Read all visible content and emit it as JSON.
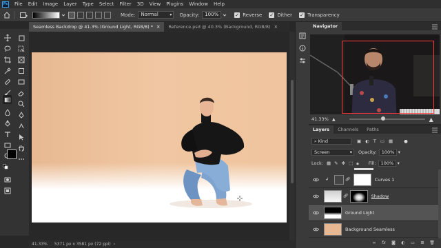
{
  "menu": {
    "logo": "Ps",
    "items": [
      "File",
      "Edit",
      "Image",
      "Layer",
      "Type",
      "Select",
      "Filter",
      "3D",
      "View",
      "Plugins",
      "Window",
      "Help"
    ]
  },
  "options": {
    "mode_label": "Mode:",
    "mode_value": "Normal",
    "opacity_label": "Opacity:",
    "opacity_value": "100%",
    "reverse_label": "Reverse",
    "dither_label": "Dither",
    "transparency_label": "Transparency"
  },
  "tabs": [
    {
      "label": "Seamless Backdrop @ 41.3% (Ground Light, RGB/8) *",
      "active": true
    },
    {
      "label": "Reference.psd @ 40.3% (Background, RGB/8)",
      "active": false
    }
  ],
  "status": {
    "zoom": "41.33%",
    "doc_info": "5371 px x 3581 px (72 ppi)",
    "arrow": "›"
  },
  "navigator": {
    "tab": "Navigator",
    "zoom": "41.33%",
    "slider_fraction": 0.45
  },
  "layers": {
    "tabs": [
      "Layers",
      "Channels",
      "Paths"
    ],
    "kind_label": "Kind",
    "blend_mode": "Screen",
    "opacity_label": "Opacity:",
    "opacity_value": "100%",
    "lock_label": "Lock:",
    "fill_label": "Fill:",
    "fill_value": "100%",
    "items": [
      {
        "name": "Curves 1"
      },
      {
        "name": "Shadow"
      },
      {
        "name": "Ground Light"
      },
      {
        "name": "Background Seamless"
      }
    ]
  },
  "colors": {
    "accent": "#31a8ff",
    "backdrop": "#efc29d",
    "selected_layer": "#545454"
  }
}
